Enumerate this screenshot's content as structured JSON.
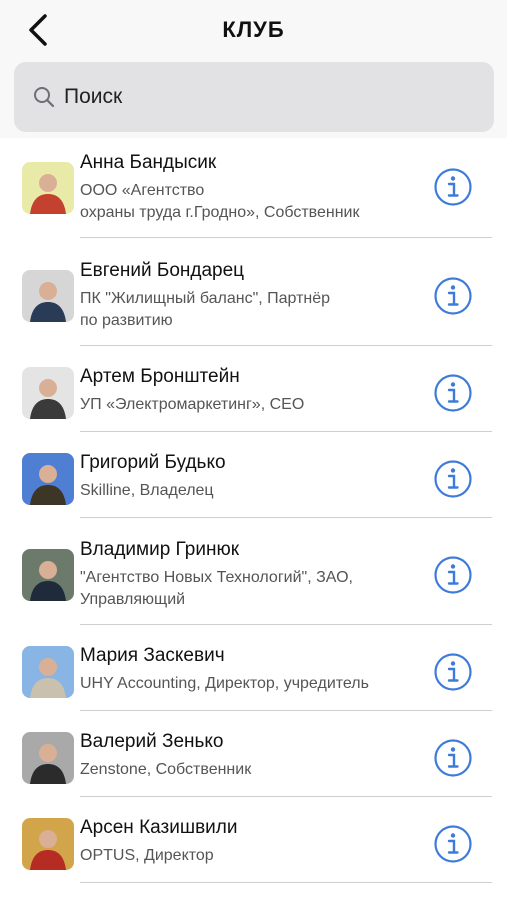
{
  "header": {
    "title": "КЛУБ"
  },
  "search": {
    "placeholder": "Поиск"
  },
  "members": [
    {
      "name": "Анна  Бандысик",
      "subtitle": "ООО «Агентство\n охраны труда г.Гродно», Собственник",
      "avatar_colors": [
        "#e9eaa8",
        "#c3412e"
      ]
    },
    {
      "name": "Евгений  Бондарец",
      "subtitle": "ПК \"Жилищный баланс\", Партнёр\nпо развитию",
      "avatar_colors": [
        "#d6d6d6",
        "#2a3b57"
      ]
    },
    {
      "name": "Артем  Бронштейн",
      "subtitle": "УП «Электромаркетинг», CEO",
      "avatar_colors": [
        "#e4e4e4",
        "#3a3a3a"
      ]
    },
    {
      "name": "Григорий  Будько",
      "subtitle": "Skilline, Владелец",
      "avatar_colors": [
        "#4f7fd3",
        "#3d3526"
      ]
    },
    {
      "name": "Владимир  Гринюк",
      "subtitle": "\"Агентство Новых Технологий\", ЗАО,\nУправляющий",
      "avatar_colors": [
        "#6b7a6a",
        "#1f2a3b"
      ]
    },
    {
      "name": "Мария  Заскевич",
      "subtitle": "UHY Accounting, Директор, учредитель",
      "avatar_colors": [
        "#88b5e3",
        "#c9c0ad"
      ]
    },
    {
      "name": "Валерий  Зенько",
      "subtitle": "Zenstone, Собственник",
      "avatar_colors": [
        "#a9a9a9",
        "#2b2b2b"
      ]
    },
    {
      "name": "Арсен  Казишвили",
      "subtitle": "OPTUS, Директор",
      "avatar_colors": [
        "#d3a54a",
        "#b62b23"
      ]
    }
  ],
  "colors": {
    "accent": "#3d7bd9",
    "header_bg": "#f8f8f8",
    "search_bg": "#e2e2e4"
  },
  "icons": {
    "back": "chevron-left-icon",
    "search": "search-icon",
    "info": "info-circle-icon"
  }
}
